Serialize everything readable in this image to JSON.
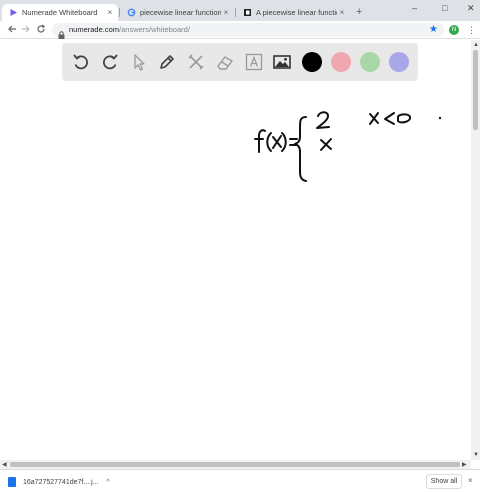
{
  "browser": {
    "tabs": [
      {
        "title": "Numerade Whiteboard",
        "icon": "numerade-play-icon",
        "active": true
      },
      {
        "title": "piecewise linear function? - Goog",
        "icon": "google-g-icon",
        "active": false
      },
      {
        "title": "A piecewise linear function is gra",
        "icon": "numerade-book-icon",
        "active": false
      }
    ],
    "new_tab_label": "+",
    "close_glyph": "×",
    "window_controls": {
      "minimize": "–",
      "maximize": "□",
      "close": "✕"
    },
    "url_domain": "numerade.com",
    "url_path": "/answers/whiteboard/",
    "profile_initial": "N",
    "icons": {
      "back": "back-arrow-icon",
      "forward": "forward-arrow-icon",
      "reload": "reload-icon",
      "star": "bookmark-star-icon",
      "menu": "kebab-menu-icon"
    }
  },
  "palette": {
    "tools": [
      "undo",
      "redo",
      "select",
      "pen",
      "tools",
      "eraser",
      "text",
      "image"
    ],
    "colors": [
      "#000000",
      "#f0a8b0",
      "#a8d8a8",
      "#a8a8e8"
    ]
  },
  "whiteboard": {
    "handwriting": {
      "lhs": "f(x)=",
      "case1_value": "2",
      "case1_condition": "x<0",
      "case2_value": "x"
    }
  },
  "downloads": {
    "file_name": "16a727527741de7f....j...",
    "show_all": "Show all"
  },
  "accent": "#1a73e8"
}
